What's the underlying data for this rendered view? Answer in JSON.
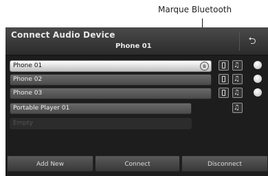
{
  "callout": {
    "label": "Marque Bluetooth"
  },
  "header": {
    "title": "Connect Audio Device",
    "subtitle": "Phone 01",
    "back_icon": "back-arrow-icon"
  },
  "devices": [
    {
      "name": "Phone 01",
      "selected": true,
      "bluetooth_marked": true
    },
    {
      "name": "Phone 02",
      "selected": false
    },
    {
      "name": "Phone 03",
      "selected": false
    },
    {
      "name": "Portable Player 01",
      "selected": false
    },
    {
      "name": "Empty",
      "selected": false
    }
  ],
  "buttons": {
    "add_new": "Add New",
    "connect": "Connect",
    "disconnect": "Disconnect"
  },
  "bluetooth_symbol": "ʙ"
}
